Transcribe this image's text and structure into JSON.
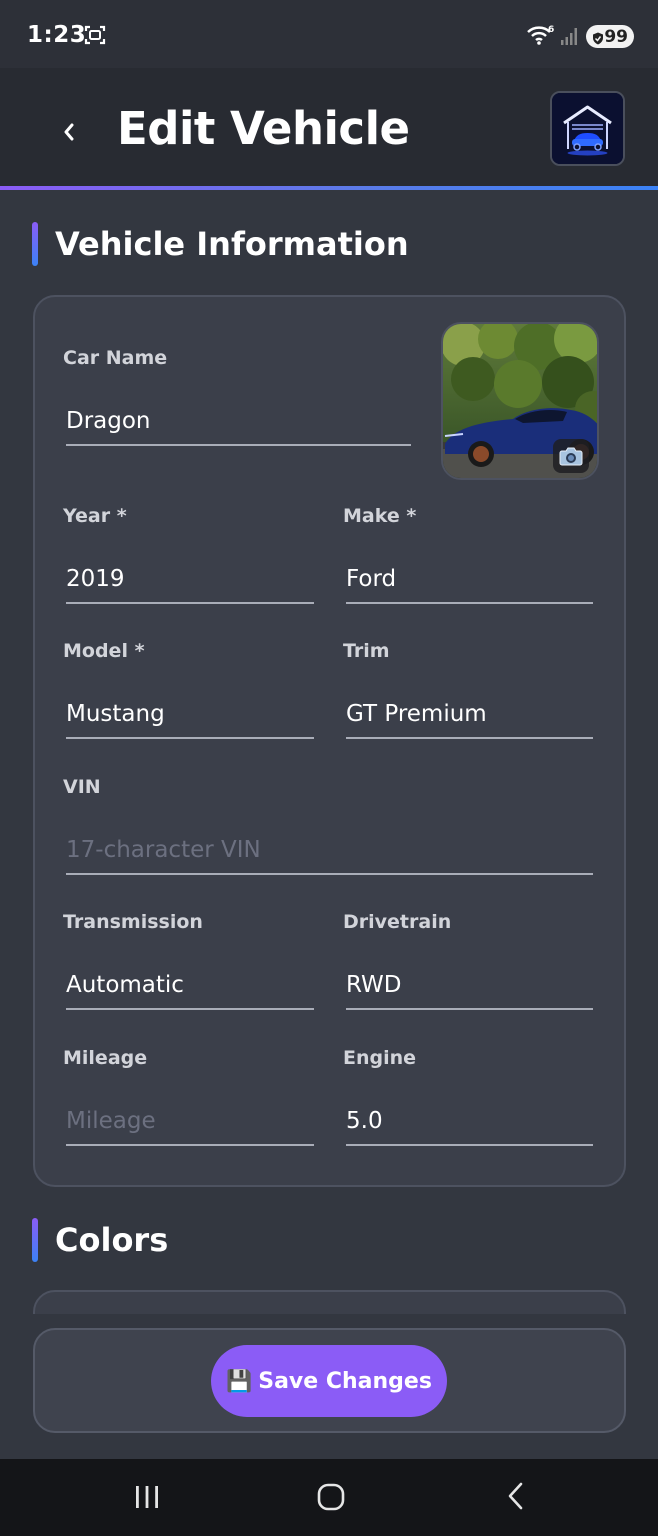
{
  "status_bar": {
    "time": "1:23",
    "battery": "99",
    "network_badge": "6"
  },
  "header": {
    "title": "Edit Vehicle",
    "back_glyph": "‹"
  },
  "sections": {
    "vehicle_info": "Vehicle Information",
    "colors": "Colors"
  },
  "fields": {
    "car_name": {
      "label": "Car Name",
      "value": "Dragon",
      "placeholder": ""
    },
    "year": {
      "label": "Year *",
      "value": "2019"
    },
    "make": {
      "label": "Make *",
      "value": "Ford"
    },
    "model": {
      "label": "Model *",
      "value": "Mustang"
    },
    "trim": {
      "label": "Trim",
      "value": "GT Premium"
    },
    "vin": {
      "label": "VIN",
      "value": "",
      "placeholder": "17-character VIN"
    },
    "transmission": {
      "label": "Transmission",
      "value": "Automatic"
    },
    "drivetrain": {
      "label": "Drivetrain",
      "value": "RWD"
    },
    "mileage": {
      "label": "Mileage",
      "value": "",
      "placeholder": "Mileage"
    },
    "engine": {
      "label": "Engine",
      "value": "5.0"
    }
  },
  "actions": {
    "save_icon": "💾",
    "save_label": "Save Changes"
  },
  "icons": {
    "car_photo": "car-photo",
    "camera": "camera-icon",
    "logo": "garage-logo-icon"
  },
  "colors": {
    "background": "#333740",
    "card": "#3b3f4a",
    "accent_purple": "#8b5cf6",
    "accent_blue": "#3b82f6"
  }
}
